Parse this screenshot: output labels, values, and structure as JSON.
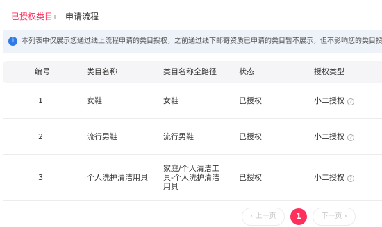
{
  "colors": {
    "accent": "#ff2e5b",
    "info_icon": "#2f7ae5",
    "notice_bg": "#eef2f9",
    "header_bg": "#f5f5f7"
  },
  "tabs": [
    {
      "label": "已授权类目",
      "active": true
    },
    {
      "label": "申请流程",
      "active": false
    }
  ],
  "notice": {
    "icon": "info-icon",
    "text": "本列表中仅展示您通过线上流程申请的类目授权，之前通过线下邮寄资质已申请的类目暂不展示，但不影响您的类目授权和商品发布，请"
  },
  "table": {
    "columns": [
      "编号",
      "类目名称",
      "类目名称全路径",
      "状态",
      "授权类型"
    ],
    "rows": [
      {
        "no": "1",
        "name": "女鞋",
        "path": "女鞋",
        "status": "已授权",
        "type": "小二授权"
      },
      {
        "no": "2",
        "name": "流行男鞋",
        "path": "流行男鞋",
        "status": "已授权",
        "type": "小二授权"
      },
      {
        "no": "3",
        "name": "个人洗护清洁用具",
        "path": "家庭/个人清洁工具-个人洗护清洁用具",
        "status": "已授权",
        "type": "小二授权"
      }
    ]
  },
  "pagination": {
    "prev_label": "‹ 上一页",
    "current": "1",
    "next_label": "下一页 ›"
  }
}
